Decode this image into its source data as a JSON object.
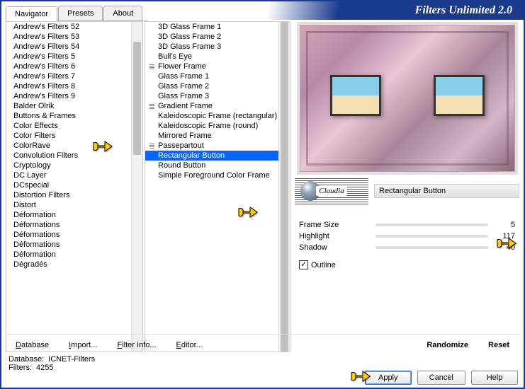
{
  "title": "Filters Unlimited 2.0",
  "tabs": [
    {
      "label": "Navigator",
      "active": true
    },
    {
      "label": "Presets",
      "active": false
    },
    {
      "label": "About",
      "active": false
    }
  ],
  "categories": [
    "Andrew's Filters 52",
    "Andrew's Filters 53",
    "Andrew's Filters 54",
    "Andrew's Filters 5",
    "Andrew's Filters 6",
    "Andrew's Filters 7",
    "Andrew's Filters 8",
    "Andrew's Filters 9",
    "Balder Olrik",
    "Buttons & Frames",
    "Color Effects",
    "Color Filters",
    "ColorRave",
    "Convolution Filters",
    "Cryptology",
    "DC Layer",
    "DCspecial",
    "Distortion Filters",
    "Distort",
    "Déformation",
    "Déformations",
    "Déformations",
    "Déformations",
    "Déformation",
    "Dégradés"
  ],
  "selected_category": "Buttons & Frames",
  "filters": [
    {
      "label": "3D Glass Frame 1",
      "children": false
    },
    {
      "label": "3D Glass Frame 2",
      "children": false
    },
    {
      "label": "3D Glass Frame 3",
      "children": false
    },
    {
      "label": "Bull's Eye",
      "children": false
    },
    {
      "label": "Flower Frame",
      "children": true
    },
    {
      "label": "Glass Frame 1",
      "children": false
    },
    {
      "label": "Glass Frame 2",
      "children": false
    },
    {
      "label": "Glass Frame 3",
      "children": false
    },
    {
      "label": "Gradient Frame",
      "children": true
    },
    {
      "label": "Kaleidoscopic Frame (rectangular)",
      "children": false
    },
    {
      "label": "Kaleidoscopic Frame (round)",
      "children": false
    },
    {
      "label": "Mirrored Frame",
      "children": false
    },
    {
      "label": "Passepartout",
      "children": true
    },
    {
      "label": "Rectangular Button",
      "children": false,
      "selected": true
    },
    {
      "label": "Round Button",
      "children": false
    },
    {
      "label": "Simple Foreground Color Frame",
      "children": false
    }
  ],
  "logo_text": "Claudia",
  "current_filter_name": "Rectangular Button",
  "params": [
    {
      "label": "Frame Size",
      "value": 5
    },
    {
      "label": "Highlight",
      "value": 117
    },
    {
      "label": "Shadow",
      "value": 40
    }
  ],
  "outline_checkbox": {
    "label": "Outline",
    "checked": true
  },
  "toolbar": {
    "database": "Database",
    "import": "Import...",
    "filter_info": "Filter Info...",
    "editor": "Editor...",
    "randomize": "Randomize",
    "reset": "Reset"
  },
  "status": {
    "db_label": "Database:",
    "db_value": "ICNET-Filters",
    "filters_label": "Filters:",
    "filters_value": "4255"
  },
  "actions": {
    "apply": "Apply",
    "cancel": "Cancel",
    "help": "Help"
  }
}
